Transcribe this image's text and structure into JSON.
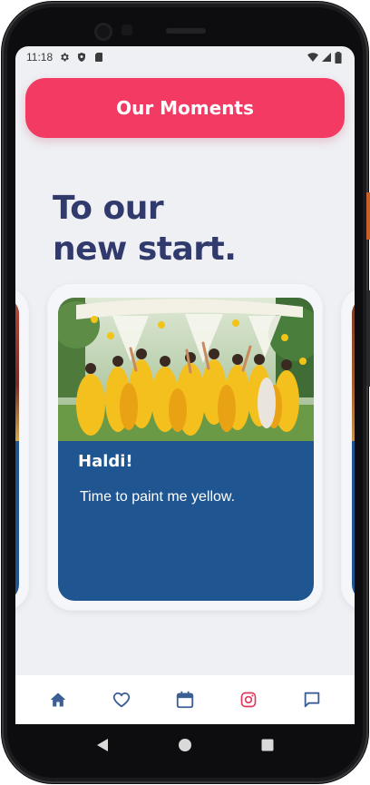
{
  "status_bar": {
    "time": "11:18",
    "icons": [
      "gear-icon",
      "shield-icon",
      "sim-card-icon",
      "wifi-icon",
      "signal-icon",
      "battery-icon"
    ]
  },
  "header": {
    "title": "Our Moments"
  },
  "hero": {
    "line1": "To our",
    "line2": "new start."
  },
  "card": {
    "title": "Haldi!",
    "description": "Time to paint me yellow."
  },
  "bottom_nav": {
    "items": [
      {
        "icon": "home-icon",
        "active": true
      },
      {
        "icon": "heart-icon",
        "active": false
      },
      {
        "icon": "calendar-icon",
        "active": false
      },
      {
        "icon": "instagram-icon",
        "active": false
      },
      {
        "icon": "chat-icon",
        "active": false
      }
    ]
  },
  "colors": {
    "accent": "#f23a63",
    "title": "#303a6c",
    "card": "#1f5591",
    "nav_icon": "#3b5e93",
    "instagram": "#e0395c"
  }
}
